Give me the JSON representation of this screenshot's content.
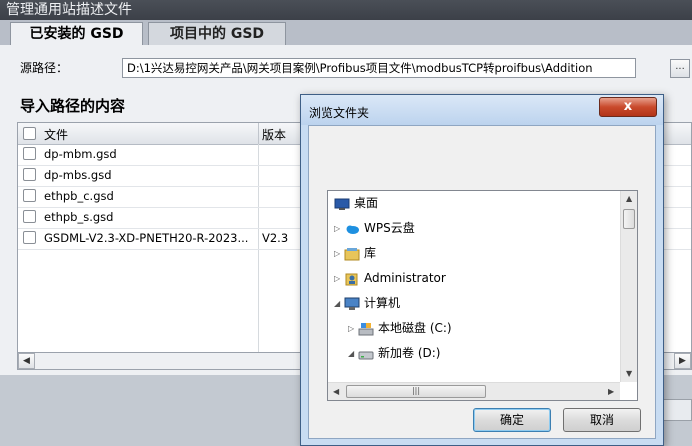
{
  "window": {
    "title": "管理通用站描述文件"
  },
  "tabs": [
    {
      "label": "已安装的 GSD"
    },
    {
      "label": "项目中的 GSD"
    }
  ],
  "source": {
    "label": "源路径：",
    "path": "D:\\1兴达易控网关产品\\网关项目案例\\Profibus项目文件\\modbusTCP转proifbus\\Addition",
    "browse_label": "..."
  },
  "import": {
    "title": "导入路径的内容",
    "columns": [
      "文件",
      "版本"
    ],
    "rows": [
      {
        "file": "dp-mbm.gsd",
        "version": ""
      },
      {
        "file": "dp-mbs.gsd",
        "version": ""
      },
      {
        "file": "ethpb_c.gsd",
        "version": ""
      },
      {
        "file": "ethpb_s.gsd",
        "version": ""
      },
      {
        "file": "GSDML-V2.3-XD-PNETH20-R-2023...",
        "version": "V2.3"
      }
    ]
  },
  "dialog": {
    "title": "浏览文件夹",
    "close_label": "x",
    "tree": [
      {
        "label": "桌面",
        "icon": "desktop-icon",
        "expander": ""
      },
      {
        "label": "WPS云盘",
        "icon": "cloud-icon",
        "expander": "▷"
      },
      {
        "label": "库",
        "icon": "library-icon",
        "expander": "▷"
      },
      {
        "label": "Administrator",
        "icon": "user-folder-icon",
        "expander": "▷"
      },
      {
        "label": "计算机",
        "icon": "computer-icon",
        "expander": "◢"
      },
      {
        "label": "本地磁盘 (C:)",
        "icon": "system-drive-icon",
        "expander": "▷"
      },
      {
        "label": "新加卷 (D:)",
        "icon": "drive-icon",
        "expander": "◢"
      }
    ],
    "ok_label": "确定",
    "cancel_label": "取消"
  },
  "colors": {
    "title_bar": "#3c4048",
    "dialog_frame": "#c8dcf2",
    "close_button": "#c94a2c"
  }
}
